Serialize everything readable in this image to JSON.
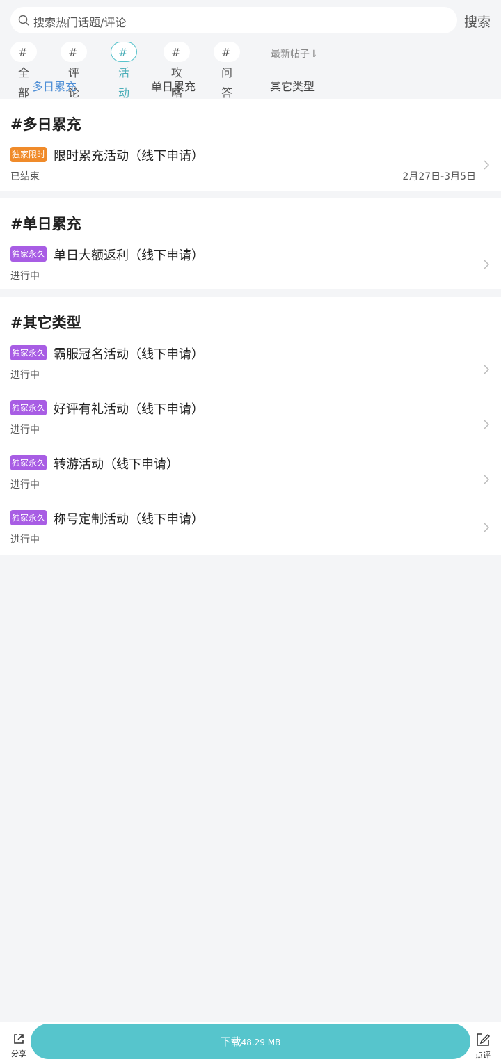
{
  "search": {
    "placeholder": "搜索热门话题/评论",
    "button": "搜索"
  },
  "chips": [
    "#全部",
    "#评论",
    "#活动",
    "#攻略",
    "#问答"
  ],
  "sort_label": "最新帖子⇂",
  "subtabs": [
    "多日累充",
    "单日累充",
    "其它类型"
  ],
  "sections": [
    {
      "title": "#多日累充",
      "items": [
        {
          "badge": "独家限时",
          "title": "限时累充活动（线下申请）",
          "status": "已结束",
          "date": "2月27日-3月5日"
        }
      ]
    },
    {
      "title": "#单日累充",
      "items": [
        {
          "badge": "独家永久",
          "title": "单日大额返利（线下申请）",
          "status": "进行中"
        }
      ]
    },
    {
      "title": "#其它类型",
      "items": [
        {
          "badge": "独家永久",
          "title": "霸服冠名活动（线下申请）",
          "status": "进行中"
        },
        {
          "badge": "独家永久",
          "title": "好评有礼活动（线下申请）",
          "status": "进行中"
        },
        {
          "badge": "独家永久",
          "title": "转游活动（线下申请）",
          "status": "进行中"
        },
        {
          "badge": "独家永久",
          "title": "称号定制活动（线下申请）",
          "status": "进行中"
        }
      ]
    }
  ],
  "bottom": {
    "share": "分享",
    "download": "下载",
    "size": "48.29 MB",
    "review": "点评"
  },
  "colors": {
    "accent": "#56c5cc",
    "active_tab": "#4f8fd6",
    "badge_limited": "#f08b2a",
    "badge_permanent": "#a85de4"
  }
}
